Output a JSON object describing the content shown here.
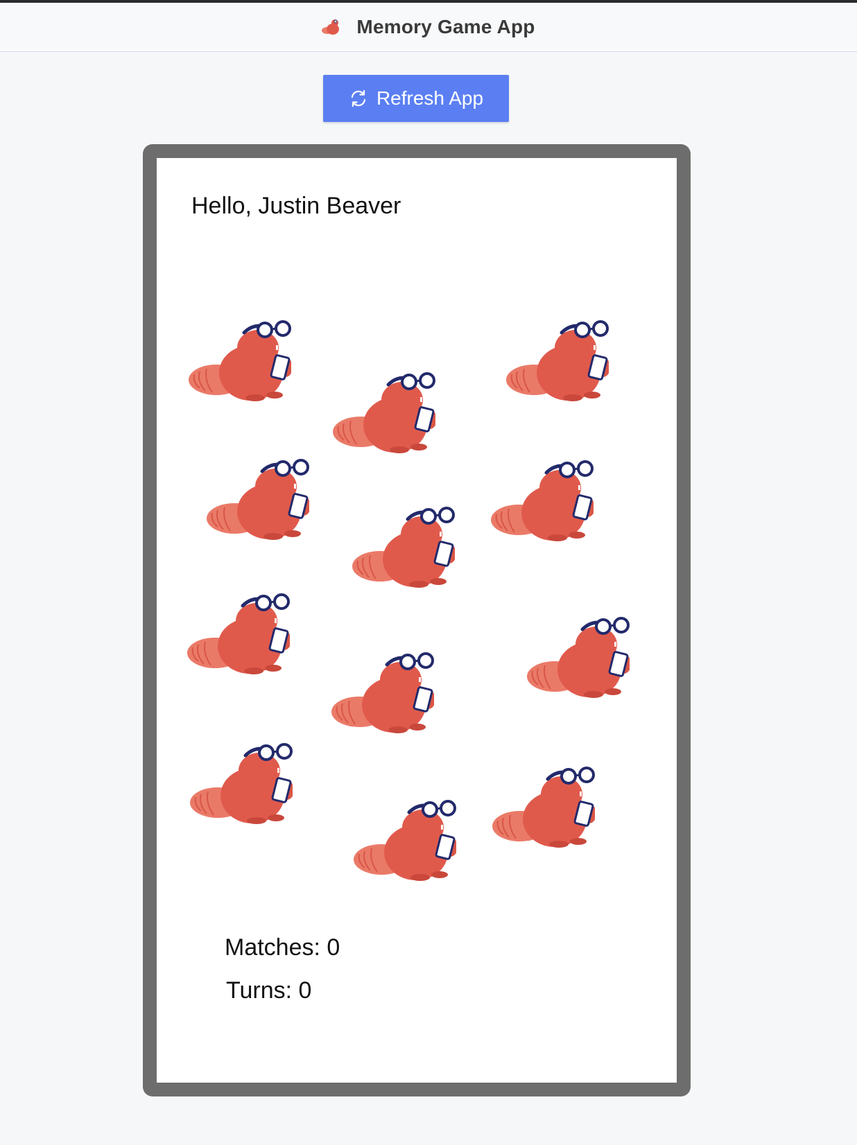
{
  "header": {
    "app_title": "Memory Game App",
    "logo_icon": "beaver-logo-icon"
  },
  "toolbar": {
    "refresh_label": "Refresh App",
    "refresh_icon": "refresh-icon"
  },
  "game": {
    "greeting": "Hello, Justin Beaver",
    "card_icon": "beaver-icon",
    "card_count": 12,
    "matches_label": "Matches: 0",
    "turns_label": "Turns: 0",
    "matches": 0,
    "turns": 0
  },
  "colors": {
    "background": "#f6f7f9",
    "accent": "#5b7ff2",
    "frame": "#6d6d6d",
    "beaver": "#e05a4c",
    "glasses": "#232a6b"
  }
}
